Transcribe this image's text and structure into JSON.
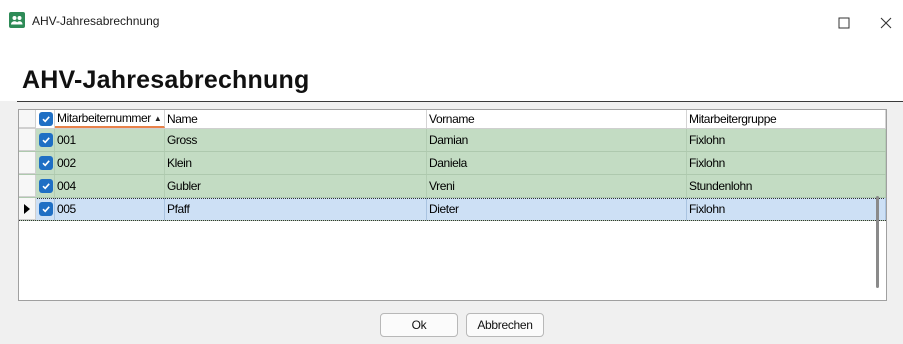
{
  "window": {
    "title": "AHV-Jahresabrechnung",
    "maximize_glyph": "□",
    "close_glyph": "✕",
    "icon": "app-icon"
  },
  "heading": "AHV-Jahresabrechnung",
  "grid": {
    "columns": [
      "Mitarbeiternummer",
      "Name",
      "Vorname",
      "Mitarbeitergruppe"
    ],
    "sort_column": "Mitarbeiternummer",
    "sort_direction": "ascending",
    "rows": [
      {
        "checked": true,
        "nummer": "001",
        "name": "Gross",
        "vorname": "Damian",
        "gruppe": "Fixlohn",
        "selected": false
      },
      {
        "checked": true,
        "nummer": "002",
        "name": "Klein",
        "vorname": "Daniela",
        "gruppe": "Fixlohn",
        "selected": false
      },
      {
        "checked": true,
        "nummer": "004",
        "name": "Gubler",
        "vorname": "Vreni",
        "gruppe": "Stundenlohn",
        "selected": false
      },
      {
        "checked": true,
        "nummer": "005",
        "name": "Pfaff",
        "vorname": "Dieter",
        "gruppe": "Fixlohn",
        "selected": true
      }
    ]
  },
  "buttons": {
    "ok": "Ok",
    "cancel": "Abbrechen"
  },
  "colors": {
    "row_checked": "#c3dcc3",
    "row_selected": "#cde0f5",
    "checkbox": "#1f6fc4",
    "sort_underline": "#e8824a"
  }
}
